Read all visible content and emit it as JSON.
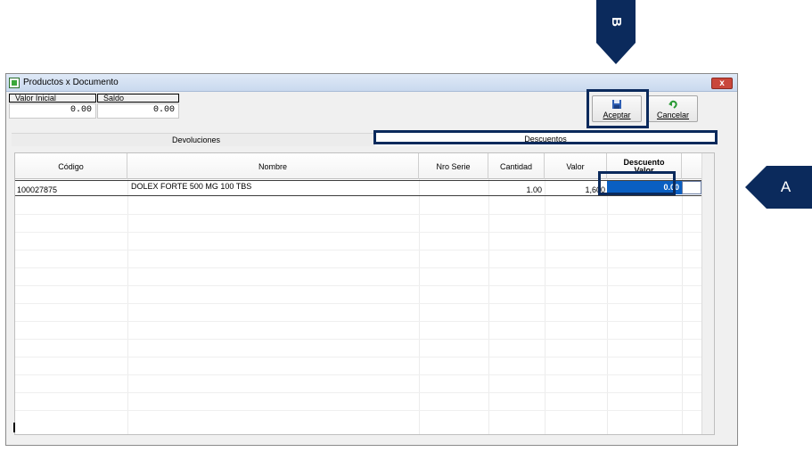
{
  "callouts": {
    "a": "A",
    "b": "B"
  },
  "window": {
    "title": "Productos x Documento",
    "close_label": "x"
  },
  "fields": {
    "valor_inicial": {
      "label": "Valor Inicial",
      "value": "0.00"
    },
    "saldo": {
      "label": "Saldo",
      "value": "0.00"
    }
  },
  "toolbar": {
    "aceptar_label": "Aceptar",
    "cancelar_label": "Cancelar"
  },
  "tabs": {
    "devoluciones": "Devoluciones",
    "descuentos": "Descuentos",
    "active": "Descuentos"
  },
  "grid": {
    "headers": {
      "codigo": "Código",
      "nombre": "Nombre",
      "nro_serie": "Nro Serie",
      "cantidad": "Cantidad",
      "valor": "Valor",
      "descuento_line1": "Descuento",
      "descuento_line2": "Valor"
    },
    "rows": [
      {
        "codigo": "100027875",
        "nombre": "DOLEX FORTE 500 MG 100 TBS",
        "nro_serie": "",
        "cantidad": "1.00",
        "valor": "1,600",
        "descuento_valor": "0.00"
      }
    ]
  },
  "colors": {
    "callout": "#0b2a5c",
    "selection": "#0a5fc2",
    "close": "#c9473b"
  },
  "icons": [
    "save-icon",
    "undo-icon",
    "document-icon",
    "close-icon"
  ]
}
